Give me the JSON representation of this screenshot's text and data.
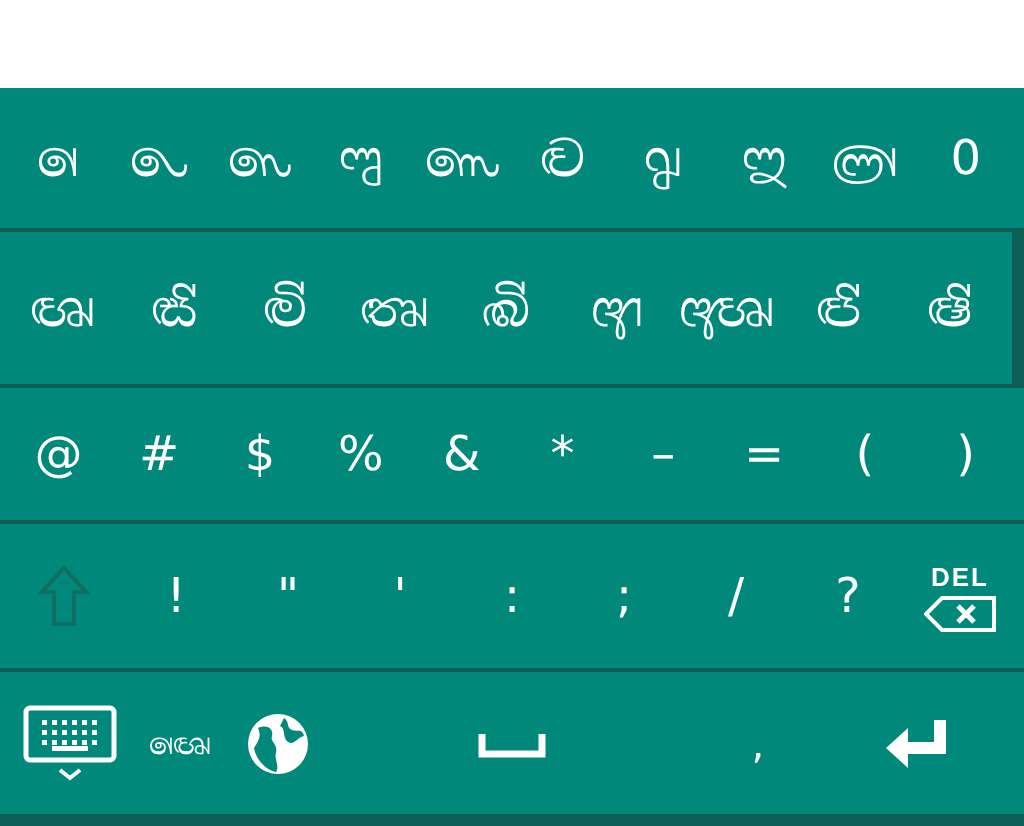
{
  "rows": [
    {
      "keys": [
        {
          "label": "𑇡"
        },
        {
          "label": "𑇢"
        },
        {
          "label": "𑇣"
        },
        {
          "label": "𑇤"
        },
        {
          "label": "𑇥"
        },
        {
          "label": "𑇦"
        },
        {
          "label": "𑇧"
        },
        {
          "label": "𑇨"
        },
        {
          "label": "𑇩"
        },
        {
          "label": "0"
        }
      ]
    },
    {
      "keys": [
        {
          "label": "𑇪"
        },
        {
          "label": "𑇫"
        },
        {
          "label": "𑇬"
        },
        {
          "label": "𑇭"
        },
        {
          "label": "𑇮"
        },
        {
          "label": "𑇯"
        },
        {
          "label": "𑇰"
        },
        {
          "label": "𑇱"
        },
        {
          "label": "𑇲"
        }
      ]
    },
    {
      "keys": [
        {
          "label": "@"
        },
        {
          "label": "#"
        },
        {
          "label": "$"
        },
        {
          "label": "%"
        },
        {
          "label": "&"
        },
        {
          "label": "*"
        },
        {
          "label": "–"
        },
        {
          "label": "="
        },
        {
          "label": "("
        },
        {
          "label": ")"
        }
      ]
    },
    {
      "keys": [
        {
          "kind": "shift",
          "disabled": true
        },
        {
          "label": "!"
        },
        {
          "label": "\""
        },
        {
          "label": "'"
        },
        {
          "label": ":"
        },
        {
          "label": ";"
        },
        {
          "label": "/"
        },
        {
          "label": "?"
        },
        {
          "kind": "delete",
          "label": "DEL"
        }
      ]
    },
    {
      "keys": [
        {
          "kind": "keyboard"
        },
        {
          "kind": "language",
          "label": "𑇡𑇪"
        },
        {
          "kind": "globe"
        },
        {
          "kind": "space"
        },
        {
          "label": ","
        },
        {
          "kind": "enter"
        }
      ]
    }
  ]
}
